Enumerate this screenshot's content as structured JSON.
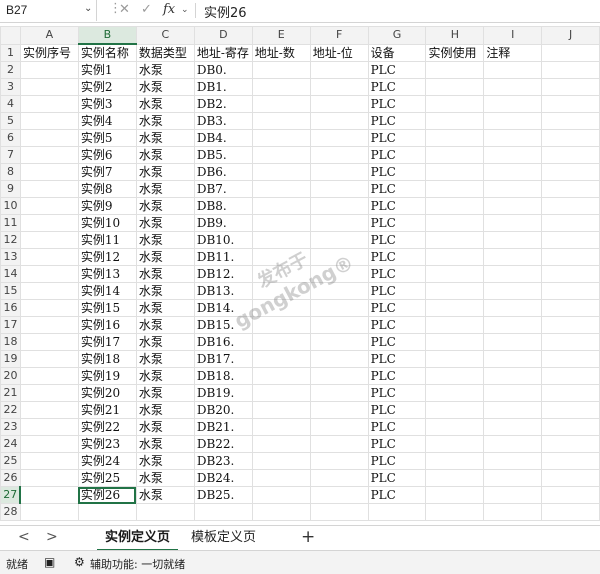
{
  "formula_bar": {
    "name_box": "B27",
    "fx": "fx",
    "cancel": "✕",
    "enter": "✓",
    "content": "实例26"
  },
  "columns": [
    "A",
    "B",
    "C",
    "D",
    "E",
    "F",
    "G",
    "H",
    "I",
    "J"
  ],
  "rows": [
    [
      "实例序号",
      "实例名称",
      "数据类型",
      "地址-寄存",
      "地址-数",
      "地址-位",
      "设备",
      "实例使用",
      "注释",
      ""
    ],
    [
      "",
      "实例1",
      "水泵",
      "DB0.",
      "",
      "",
      "PLC",
      "",
      "",
      ""
    ],
    [
      "",
      "实例2",
      "水泵",
      "DB1.",
      "",
      "",
      "PLC",
      "",
      "",
      ""
    ],
    [
      "",
      "实例3",
      "水泵",
      "DB2.",
      "",
      "",
      "PLC",
      "",
      "",
      ""
    ],
    [
      "",
      "实例4",
      "水泵",
      "DB3.",
      "",
      "",
      "PLC",
      "",
      "",
      ""
    ],
    [
      "",
      "实例5",
      "水泵",
      "DB4.",
      "",
      "",
      "PLC",
      "",
      "",
      ""
    ],
    [
      "",
      "实例6",
      "水泵",
      "DB5.",
      "",
      "",
      "PLC",
      "",
      "",
      ""
    ],
    [
      "",
      "实例7",
      "水泵",
      "DB6.",
      "",
      "",
      "PLC",
      "",
      "",
      ""
    ],
    [
      "",
      "实例8",
      "水泵",
      "DB7.",
      "",
      "",
      "PLC",
      "",
      "",
      ""
    ],
    [
      "",
      "实例9",
      "水泵",
      "DB8.",
      "",
      "",
      "PLC",
      "",
      "",
      ""
    ],
    [
      "",
      "实例10",
      "水泵",
      "DB9.",
      "",
      "",
      "PLC",
      "",
      "",
      ""
    ],
    [
      "",
      "实例11",
      "水泵",
      "DB10.",
      "",
      "",
      "PLC",
      "",
      "",
      ""
    ],
    [
      "",
      "实例12",
      "水泵",
      "DB11.",
      "",
      "",
      "PLC",
      "",
      "",
      ""
    ],
    [
      "",
      "实例13",
      "水泵",
      "DB12.",
      "",
      "",
      "PLC",
      "",
      "",
      ""
    ],
    [
      "",
      "实例14",
      "水泵",
      "DB13.",
      "",
      "",
      "PLC",
      "",
      "",
      ""
    ],
    [
      "",
      "实例15",
      "水泵",
      "DB14.",
      "",
      "",
      "PLC",
      "",
      "",
      ""
    ],
    [
      "",
      "实例16",
      "水泵",
      "DB15.",
      "",
      "",
      "PLC",
      "",
      "",
      ""
    ],
    [
      "",
      "实例17",
      "水泵",
      "DB16.",
      "",
      "",
      "PLC",
      "",
      "",
      ""
    ],
    [
      "",
      "实例18",
      "水泵",
      "DB17.",
      "",
      "",
      "PLC",
      "",
      "",
      ""
    ],
    [
      "",
      "实例19",
      "水泵",
      "DB18.",
      "",
      "",
      "PLC",
      "",
      "",
      ""
    ],
    [
      "",
      "实例20",
      "水泵",
      "DB19.",
      "",
      "",
      "PLC",
      "",
      "",
      ""
    ],
    [
      "",
      "实例21",
      "水泵",
      "DB20.",
      "",
      "",
      "PLC",
      "",
      "",
      ""
    ],
    [
      "",
      "实例22",
      "水泵",
      "DB21.",
      "",
      "",
      "PLC",
      "",
      "",
      ""
    ],
    [
      "",
      "实例23",
      "水泵",
      "DB22.",
      "",
      "",
      "PLC",
      "",
      "",
      ""
    ],
    [
      "",
      "实例24",
      "水泵",
      "DB23.",
      "",
      "",
      "PLC",
      "",
      "",
      ""
    ],
    [
      "",
      "实例25",
      "水泵",
      "DB24.",
      "",
      "",
      "PLC",
      "",
      "",
      ""
    ],
    [
      "",
      "实例26",
      "水泵",
      "DB25.",
      "",
      "",
      "PLC",
      "",
      "",
      ""
    ],
    [
      "",
      "",
      "",
      "",
      "",
      "",
      "",
      "",
      "",
      ""
    ]
  ],
  "sheet_tabs": [
    "实例定义页",
    "模板定义页"
  ],
  "add_sheet": "+",
  "nav_prev": "<",
  "nav_next": ">",
  "status": {
    "ready": "就绪",
    "accessibility": "辅助功能: 一切就绪"
  },
  "watermark": {
    "line1": "发布于",
    "line2": "gongkong®"
  },
  "accent_color": "#217346"
}
